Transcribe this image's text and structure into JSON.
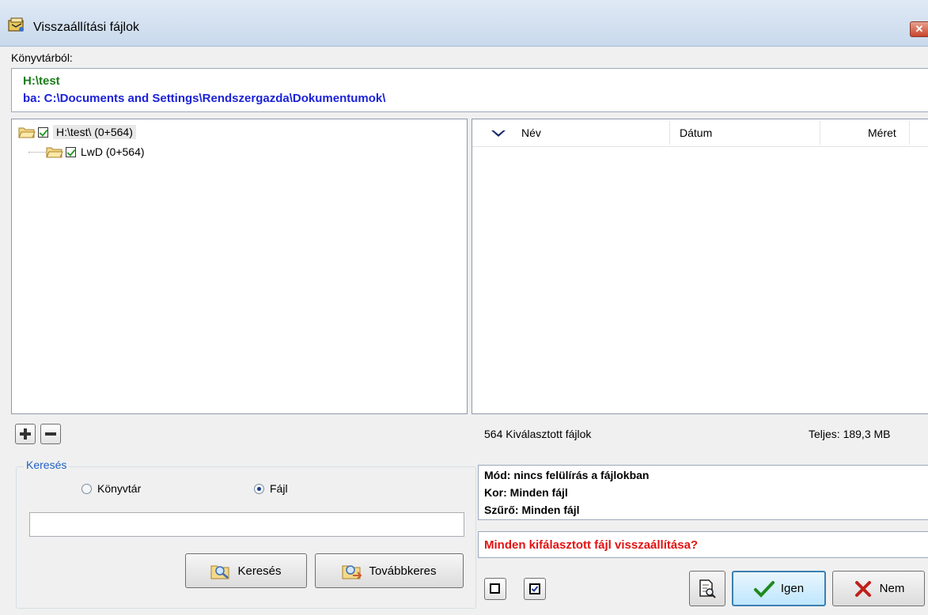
{
  "window": {
    "title": "Visszaállítási fájlok",
    "close_label": "✕"
  },
  "source": {
    "label": "Könyvtárból:",
    "path_from": "H:\\test",
    "path_to": "ba: C:\\Documents and Settings\\Rendszergazda\\Dokumentumok\\"
  },
  "tree": {
    "items": [
      {
        "label": "H:\\test\\ (0+564)",
        "checked": true,
        "expanded": true
      },
      {
        "label": "LwD (0+564)",
        "checked": true,
        "expanded": false
      }
    ]
  },
  "file_list": {
    "columns": [
      "Név",
      "Dátum",
      "Méret"
    ],
    "rows": []
  },
  "tree_buttons": {
    "expand_icon": "plus-icon",
    "collapse_icon": "minus-icon"
  },
  "search": {
    "group_title": "Keresés",
    "radio_directory": "Könyvtár",
    "radio_file": "Fájl",
    "selected": "Fájl",
    "query": "",
    "search_button": "Keresés",
    "search_next_button": "Továbbkeres"
  },
  "summary": {
    "selected_files": "564 Kiválasztott fájlok",
    "total": "Teljes: 189,3 MB"
  },
  "info": {
    "mode": "Mód: nincs felülírás a fájlokban",
    "age": "Kor: Minden fájl",
    "filter": "Szűrő: Minden fájl"
  },
  "question": "Minden kifálasztott fájl visszaállítása?",
  "actions": {
    "yes": "Igen",
    "no": "Nem"
  },
  "colors": {
    "path_from": "#1a7d1a",
    "path_to": "#1c22d8",
    "question": "#e31212",
    "group_title": "#1f5fc7"
  }
}
